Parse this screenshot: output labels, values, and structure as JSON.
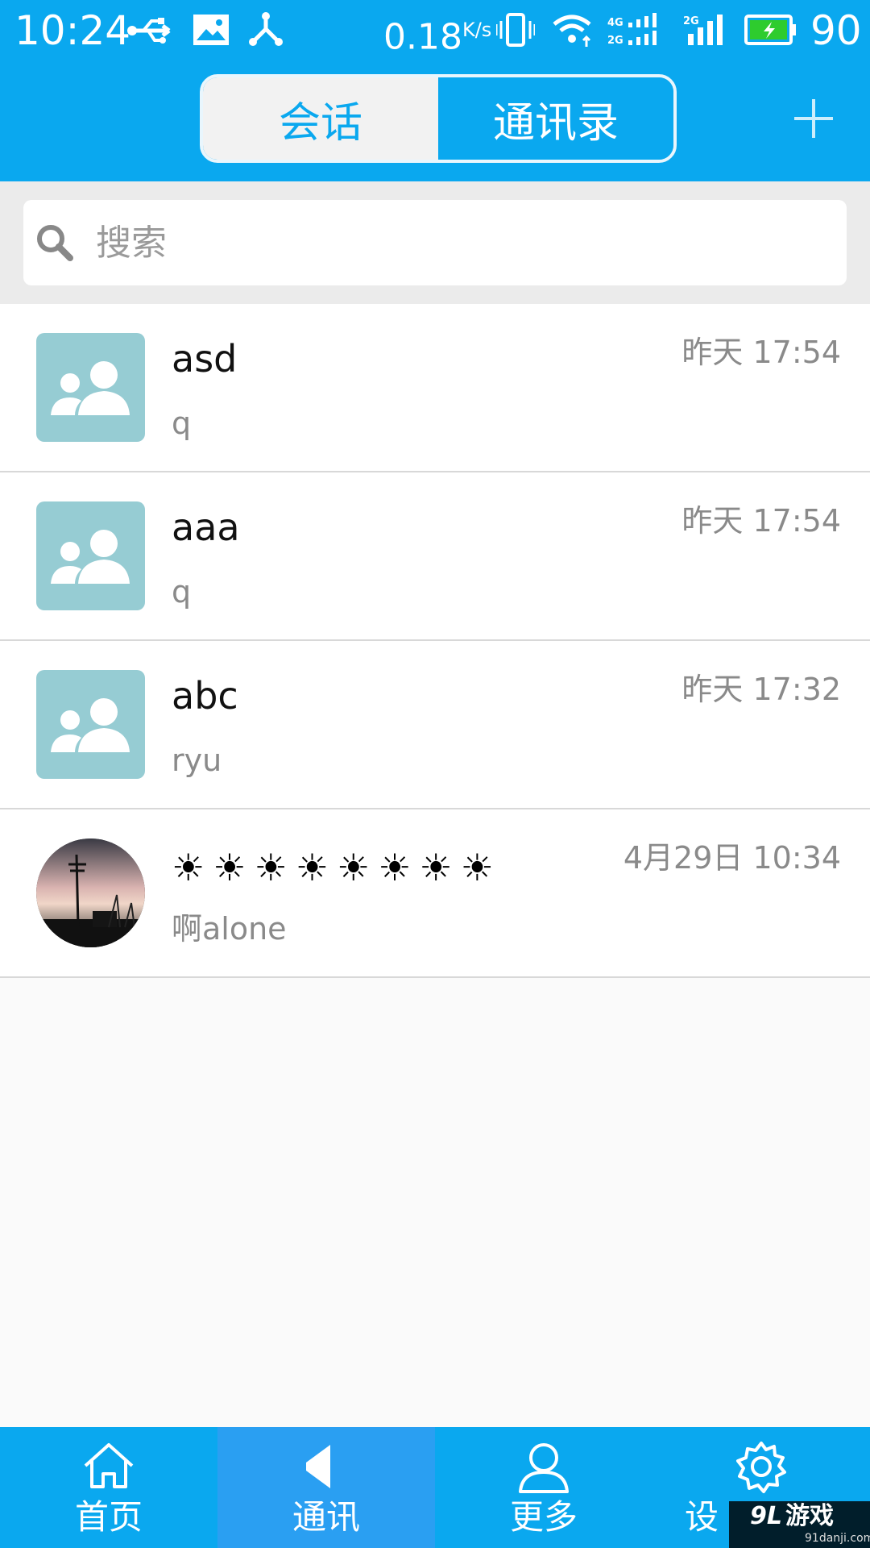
{
  "status_bar": {
    "time": "10:24",
    "speed": "0.18",
    "speed_unit": "K/s",
    "battery": "90"
  },
  "header": {
    "tabs": [
      {
        "label": "会话",
        "selected": true
      },
      {
        "label": "通讯录",
        "selected": false
      }
    ],
    "add_icon": "plus-icon"
  },
  "search": {
    "placeholder": "搜索",
    "icon": "search-icon"
  },
  "conversations": [
    {
      "name": "asd",
      "message": "q",
      "time": "昨天 17:54",
      "avatar": "group-avatar"
    },
    {
      "name": "aaa",
      "message": "q",
      "time": "昨天 17:54",
      "avatar": "group-avatar"
    },
    {
      "name": "abc",
      "message": "ryu",
      "time": "昨天 17:32",
      "avatar": "group-avatar"
    },
    {
      "name": "☀☀☀☀☀☀☀☀",
      "message": "啊alone",
      "time": "4月29日 10:34",
      "avatar": "photo-avatar"
    }
  ],
  "bottom_nav": [
    {
      "label": "首页",
      "icon": "home-icon",
      "active": false
    },
    {
      "label": "通讯",
      "icon": "speaker-icon",
      "active": true
    },
    {
      "label": "更多",
      "icon": "person-icon",
      "active": false
    },
    {
      "label": "设",
      "icon": "gear-icon",
      "active": false
    }
  ],
  "watermark": {
    "logo": "9L",
    "text": "游戏",
    "url": "91danji.com"
  },
  "colors": {
    "primary": "#0aa8ef",
    "active_nav": "#2a9ff2",
    "avatar_bg": "#96ccd3"
  }
}
